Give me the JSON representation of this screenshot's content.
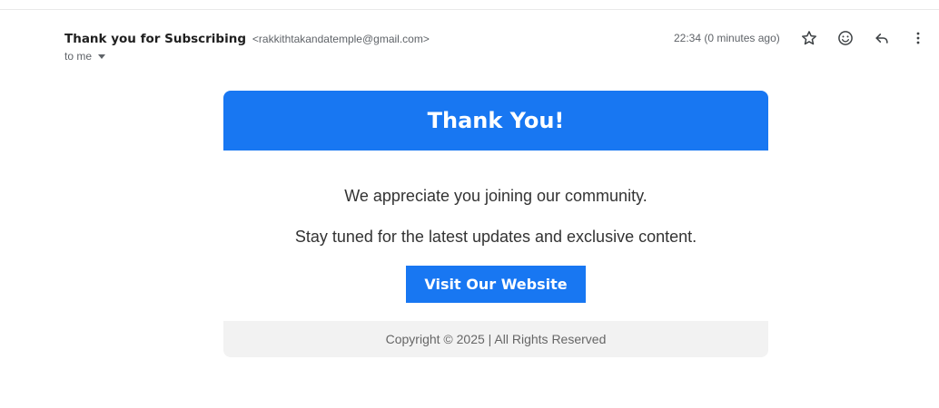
{
  "email": {
    "subject_sender": "Thank you for Subscribing",
    "sender_email": "<rakkithtakandatemple@gmail.com>",
    "recipient": "to me",
    "timestamp": "22:34 (0 minutes ago)"
  },
  "actions": {
    "star_icon": "star-icon",
    "emoji_icon": "emoji-icon",
    "reply_icon": "reply-icon",
    "more_icon": "more-vertical-icon"
  },
  "content": {
    "banner_title": "Thank You!",
    "paragraph_1": "We appreciate you joining our community.",
    "paragraph_2": "Stay tuned for the latest updates and exclusive content.",
    "button_label": "Visit Our Website",
    "footer_text": "Copyright © 2025 | All Rights Reserved"
  },
  "colors": {
    "accent": "#1877f2",
    "footer_bg": "#f2f2f2"
  }
}
